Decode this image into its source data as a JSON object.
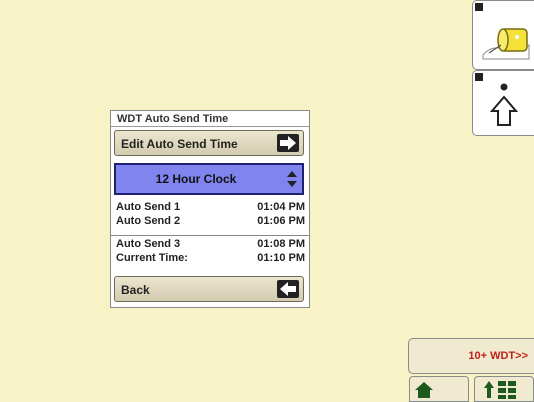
{
  "dialog": {
    "title": "WDT Auto Send Time",
    "edit_button_label": "Edit Auto Send Time",
    "clock_mode": "12 Hour Clock",
    "rows_group1": [
      {
        "label": "Auto Send 1",
        "value": "01:04 PM"
      },
      {
        "label": "Auto Send 2",
        "value": "01:06 PM"
      }
    ],
    "rows_group2": [
      {
        "label": "Auto Send 3",
        "value": "01:08 PM"
      },
      {
        "label": "Current Time:",
        "value": "01:10 PM"
      }
    ],
    "back_button_label": "Back"
  },
  "side_panels": {
    "top_tag": "F",
    "mid_tag": "G"
  },
  "bottom": {
    "wdt_label": "10+ WDT>>"
  },
  "colors": {
    "background": "#f7f3c6",
    "select_fill": "#7f84ee",
    "wdt_text": "#c0201a"
  }
}
